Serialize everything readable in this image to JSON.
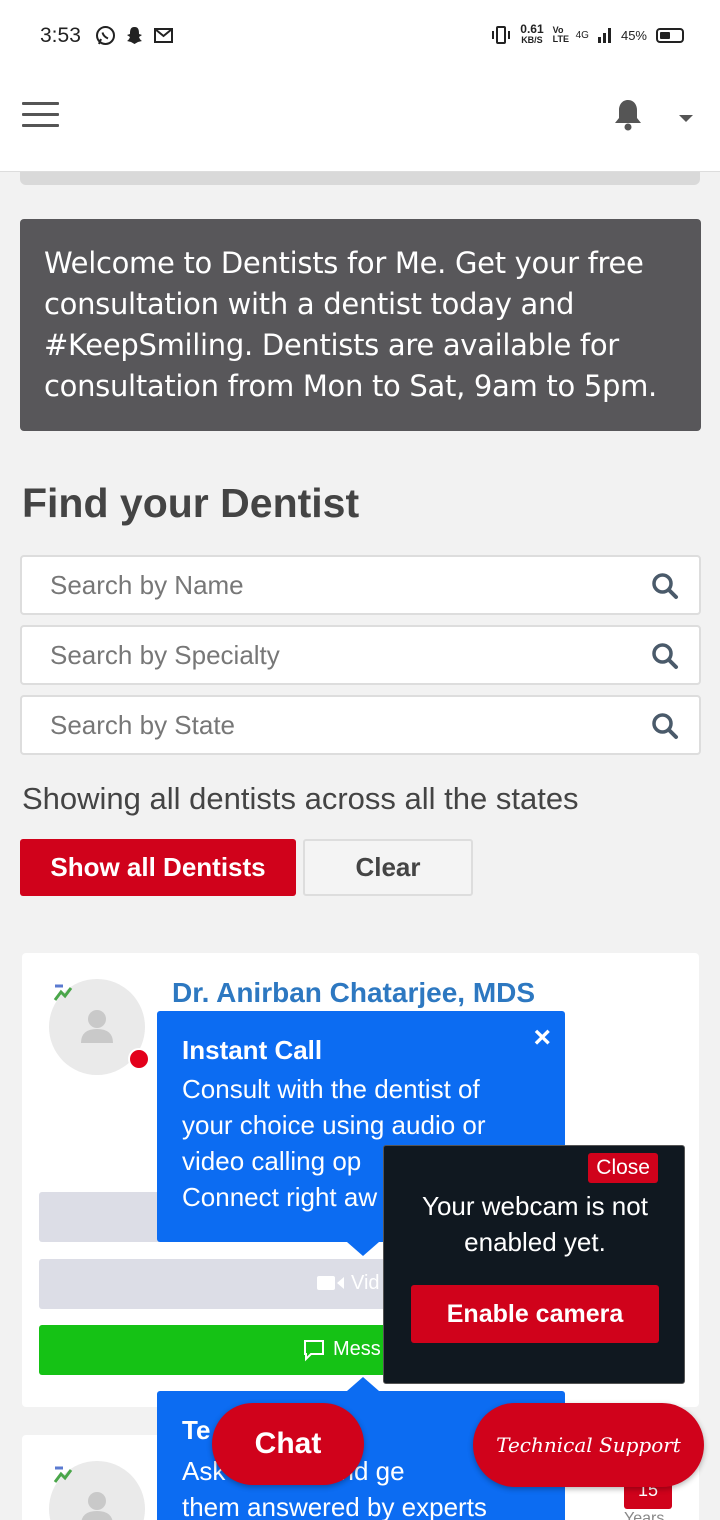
{
  "status_bar": {
    "time": "3:53",
    "net_speed": "0.61",
    "net_unit": "KB/S",
    "volte": "Vo LTE",
    "signal": "4G",
    "battery": "45%"
  },
  "header": {
    "menu_icon": "hamburger-icon",
    "bell_icon": "bell-icon",
    "dropdown_icon": "caret-down-icon"
  },
  "welcome": {
    "text": "Welcome to Dentists for Me. Get your free consultation with a dentist today and #KeepSmiling. Dentists are available for consultation from Mon to Sat, 9am to 5pm."
  },
  "find": {
    "title": "Find your Dentist",
    "search_name_placeholder": "Search by Name",
    "search_specialty_placeholder": "Search by Specialty",
    "search_state_placeholder": "Search by State",
    "showing_text": "Showing all dentists across all the states",
    "show_all_label": "Show all Dentists",
    "clear_label": "Clear"
  },
  "doctor_card": {
    "name": "Dr. Anirban Chatarjee, MDS",
    "video_label": "Vid",
    "message_label": "Mess"
  },
  "instant_call_tip": {
    "title": "Instant Call",
    "body": "Consult with the dentist of your choice using audio or video calling op",
    "body_line4": "Connect right aw",
    "close": "×"
  },
  "text_tip": {
    "title": "Te",
    "body_line1": "Ask        es, and ge",
    "body_line2": "them answered by experts"
  },
  "webcam_popup": {
    "close_label": "Close",
    "message": "Your webcam is not enabled yet.",
    "enable_label": "Enable camera"
  },
  "floating": {
    "chat_label": "Chat",
    "support_label": "Technical Support"
  },
  "second_card": {
    "years_value": "15",
    "years_label": "Years"
  },
  "colors": {
    "brand_red": "#d0021b",
    "tooltip_blue": "#0c6cf2",
    "link_blue": "#2d78c1",
    "message_green": "#15c215",
    "welcome_bg": "#58575a"
  }
}
